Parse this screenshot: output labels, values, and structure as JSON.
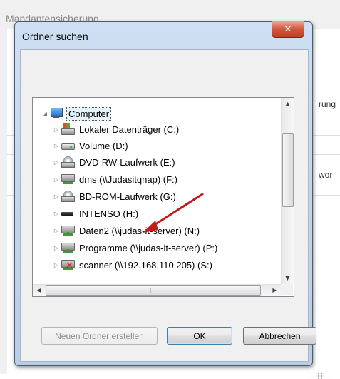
{
  "background_window": {
    "title": "Mandantensicherung",
    "fragment_1": "rung",
    "fragment_2": "wor"
  },
  "dialog": {
    "title": "Ordner suchen",
    "close_icon": "close-icon"
  },
  "tree": {
    "items": [
      {
        "label": "Computer",
        "icon": "computer-icon",
        "expander": "◢",
        "selected": true
      },
      {
        "label": "Lokaler Datenträger (C:)",
        "icon": "hdd-icon",
        "expander": "▷"
      },
      {
        "label": "Volume (D:)",
        "icon": "drive-icon",
        "expander": "▷"
      },
      {
        "label": "DVD-RW-Laufwerk (E:)",
        "icon": "disc-drive-icon",
        "expander": "▷"
      },
      {
        "label": "dms (\\\\Judasitqnap) (F:)",
        "icon": "network-drive-icon",
        "expander": "▷"
      },
      {
        "label": "BD-ROM-Laufwerk (G:)",
        "icon": "disc-drive-icon",
        "expander": "▷"
      },
      {
        "label": "INTENSO (H:)",
        "icon": "usb-drive-icon",
        "expander": "▷"
      },
      {
        "label": "Daten2 (\\\\judas-it-server) (N:)",
        "icon": "network-drive-icon",
        "expander": "▷"
      },
      {
        "label": "Programme (\\\\judas-it-server) (P:)",
        "icon": "network-drive-icon",
        "expander": "▷"
      },
      {
        "label": "scanner (\\\\192.168.110.205) (S:)",
        "icon": "network-drive-disconnected-icon",
        "expander": "▷"
      }
    ],
    "scroll_up": "▲",
    "scroll_down": "▼",
    "scroll_left": "◀",
    "scroll_right": "▶",
    "hgrip": "III"
  },
  "buttons": {
    "new_folder": "Neuen Ordner erstellen",
    "ok": "OK",
    "cancel": "Abbrechen"
  },
  "colors": {
    "dialog_frame": "#b9cde7",
    "annotation_arrow": "#c41a1a",
    "close_button": "#c33d23"
  }
}
